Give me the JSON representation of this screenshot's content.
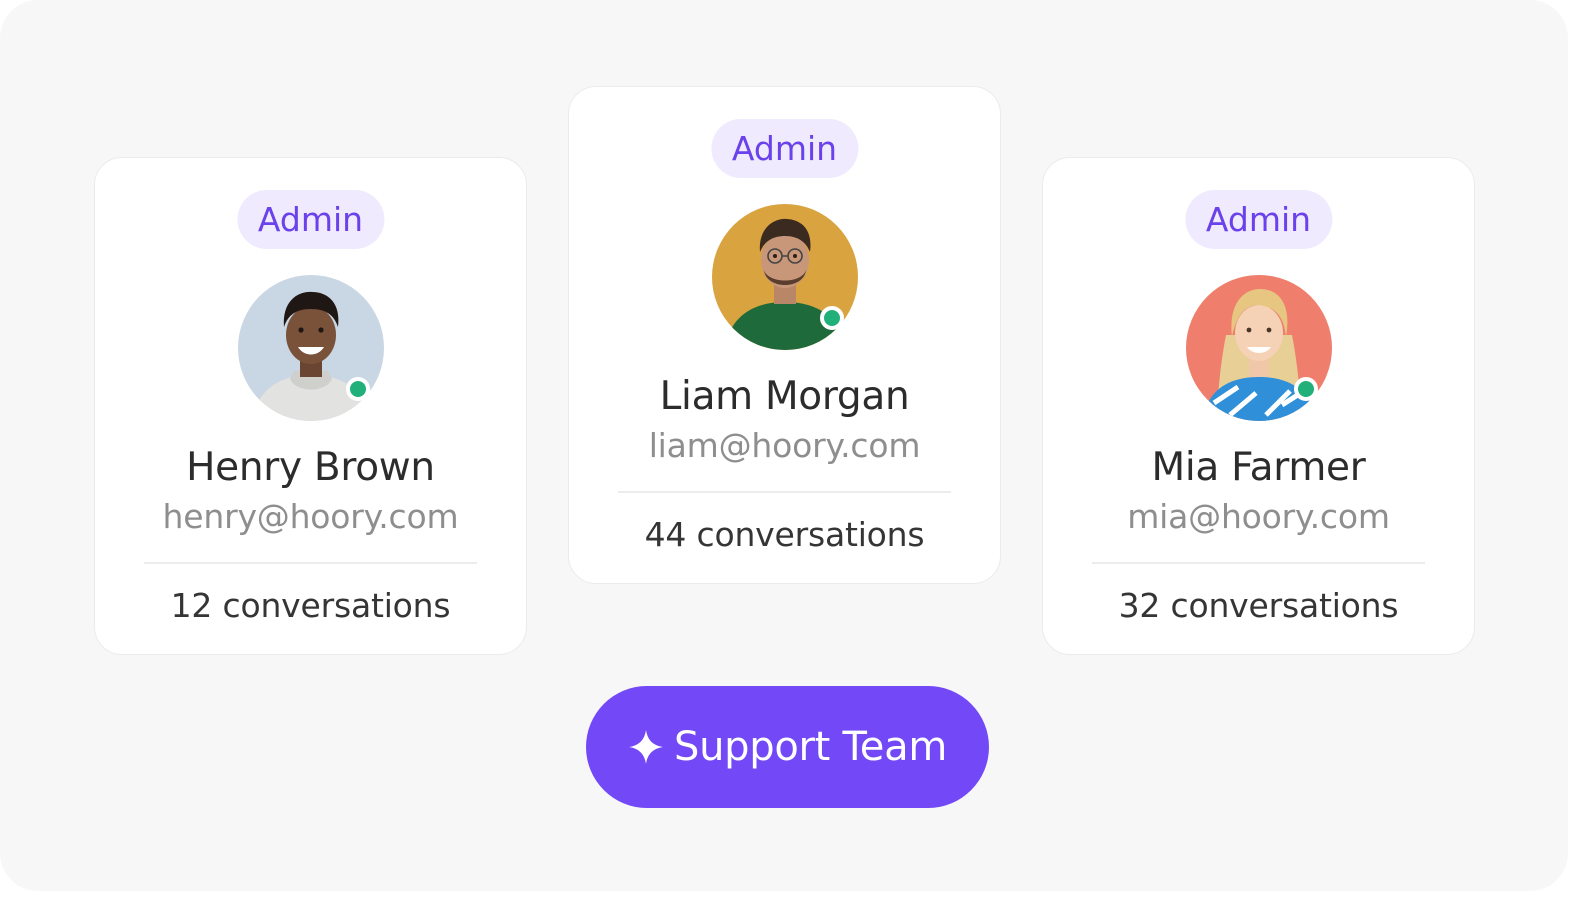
{
  "members": [
    {
      "role": "Admin",
      "name": "Henry Brown",
      "email": "henry@hoory.com",
      "conversations": "12 conversations",
      "status": "online",
      "avatar_bg": "#c9d6e4"
    },
    {
      "role": "Admin",
      "name": "Liam Morgan",
      "email": "liam@hoory.com",
      "conversations": "44 conversations",
      "status": "online",
      "avatar_bg": "#d9a33f"
    },
    {
      "role": "Admin",
      "name": "Mia Farmer",
      "email": "mia@hoory.com",
      "conversations": "32 conversations",
      "status": "online",
      "avatar_bg": "#ef7e6c"
    }
  ],
  "team_button": {
    "label": "Support Team",
    "icon": "sparkle-icon"
  },
  "colors": {
    "accent": "#7248f7",
    "badge_bg": "#efeafe",
    "badge_text": "#6a41ea",
    "online": "#21b07a"
  }
}
